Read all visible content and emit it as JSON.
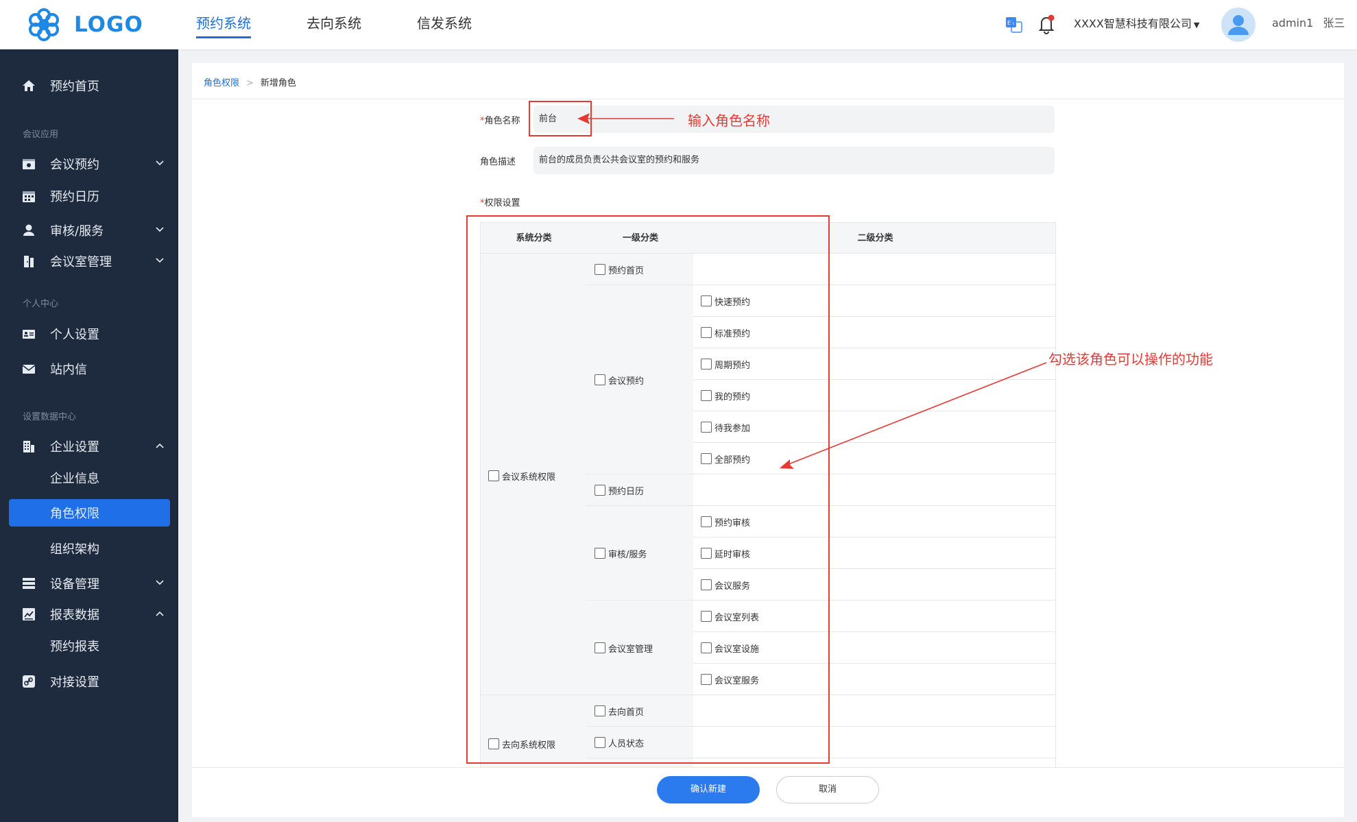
{
  "header": {
    "logo_text": "LOGO",
    "nav": [
      {
        "label": "预约系统",
        "active": true
      },
      {
        "label": "去向系统",
        "active": false
      },
      {
        "label": "信发系统",
        "active": false
      }
    ],
    "company": "XXXX智慧科技有限公司",
    "user": "admin1",
    "user_name": "张三"
  },
  "sidebar": {
    "home": "预约首页",
    "group_meeting": "会议应用",
    "meeting_booking": "会议预约",
    "booking_calendar": "预约日历",
    "review_service": "审核/服务",
    "room_manage": "会议室管理",
    "group_personal": "个人中心",
    "personal_settings": "个人设置",
    "inbox": "站内信",
    "group_data": "设置数据中心",
    "enterprise_settings": "企业设置",
    "enterprise_info": "企业信息",
    "role_permission": "角色权限",
    "org_structure": "组织架构",
    "device_manage": "设备管理",
    "report_data": "报表数据",
    "booking_report": "预约报表",
    "integration": "对接设置"
  },
  "breadcrumb": {
    "parent": "角色权限",
    "sep": ">",
    "current": "新增角色"
  },
  "form": {
    "required_mark": "*",
    "name_label": "角色名称",
    "name_value": "前台",
    "desc_label": "角色描述",
    "desc_value": "前台的成员负责公共会议室的预约和服务",
    "perm_label": "权限设置"
  },
  "table": {
    "headers": [
      "系统分类",
      "一级分类",
      "二级分类"
    ],
    "sys_meeting": "会议系统权限",
    "sys_whereabouts": "去向系统权限",
    "l1_home": "预约首页",
    "l1_booking": "会议预约",
    "l2_quick": "快速预约",
    "l2_standard": "标准预约",
    "l2_periodic": "周期预约",
    "l2_mine": "我的预约",
    "l2_pending": "待我参加",
    "l2_all": "全部预约",
    "l1_calendar": "预约日历",
    "l1_review": "审核/服务",
    "l2_booking_review": "预约审核",
    "l2_delay_review": "延时审核",
    "l2_meeting_service": "会议服务",
    "l1_room": "会议室管理",
    "l2_room_list": "会议室列表",
    "l2_room_facility": "会议室设施",
    "l2_room_service": "会议室服务",
    "l1_wh_home": "去向首页",
    "l1_person_status": "人员状态"
  },
  "buttons": {
    "confirm": "确认新建",
    "cancel": "取消"
  },
  "annotations": {
    "name_hint": "输入角色名称",
    "perm_hint": "勾选该角色可以操作的功能"
  },
  "colors": {
    "accent": "#1e6fd9",
    "sidebar_bg": "#1e2a3d",
    "annotation": "#e53935"
  }
}
